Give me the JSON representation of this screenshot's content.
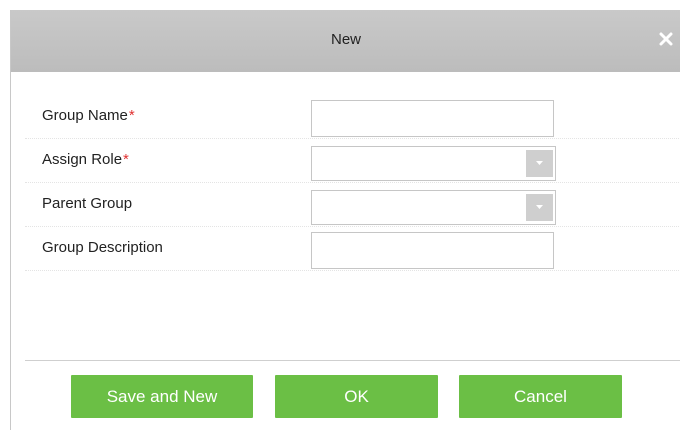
{
  "dialog": {
    "title": "New"
  },
  "form": {
    "group_name": {
      "label": "Group Name",
      "required_mark": "*",
      "value": ""
    },
    "assign_role": {
      "label": "Assign Role",
      "required_mark": "*",
      "value": ""
    },
    "parent_group": {
      "label": "Parent Group",
      "value": ""
    },
    "group_description": {
      "label": "Group Description",
      "value": ""
    }
  },
  "buttons": {
    "save_and_new": "Save and New",
    "ok": "OK",
    "cancel": "Cancel"
  },
  "icons": {
    "close": "close-icon",
    "dropdown": "chevron-down-icon"
  },
  "colors": {
    "titlebar": "#c3c3c3",
    "button_green": "#6bbf45",
    "required_red": "#e03030"
  }
}
